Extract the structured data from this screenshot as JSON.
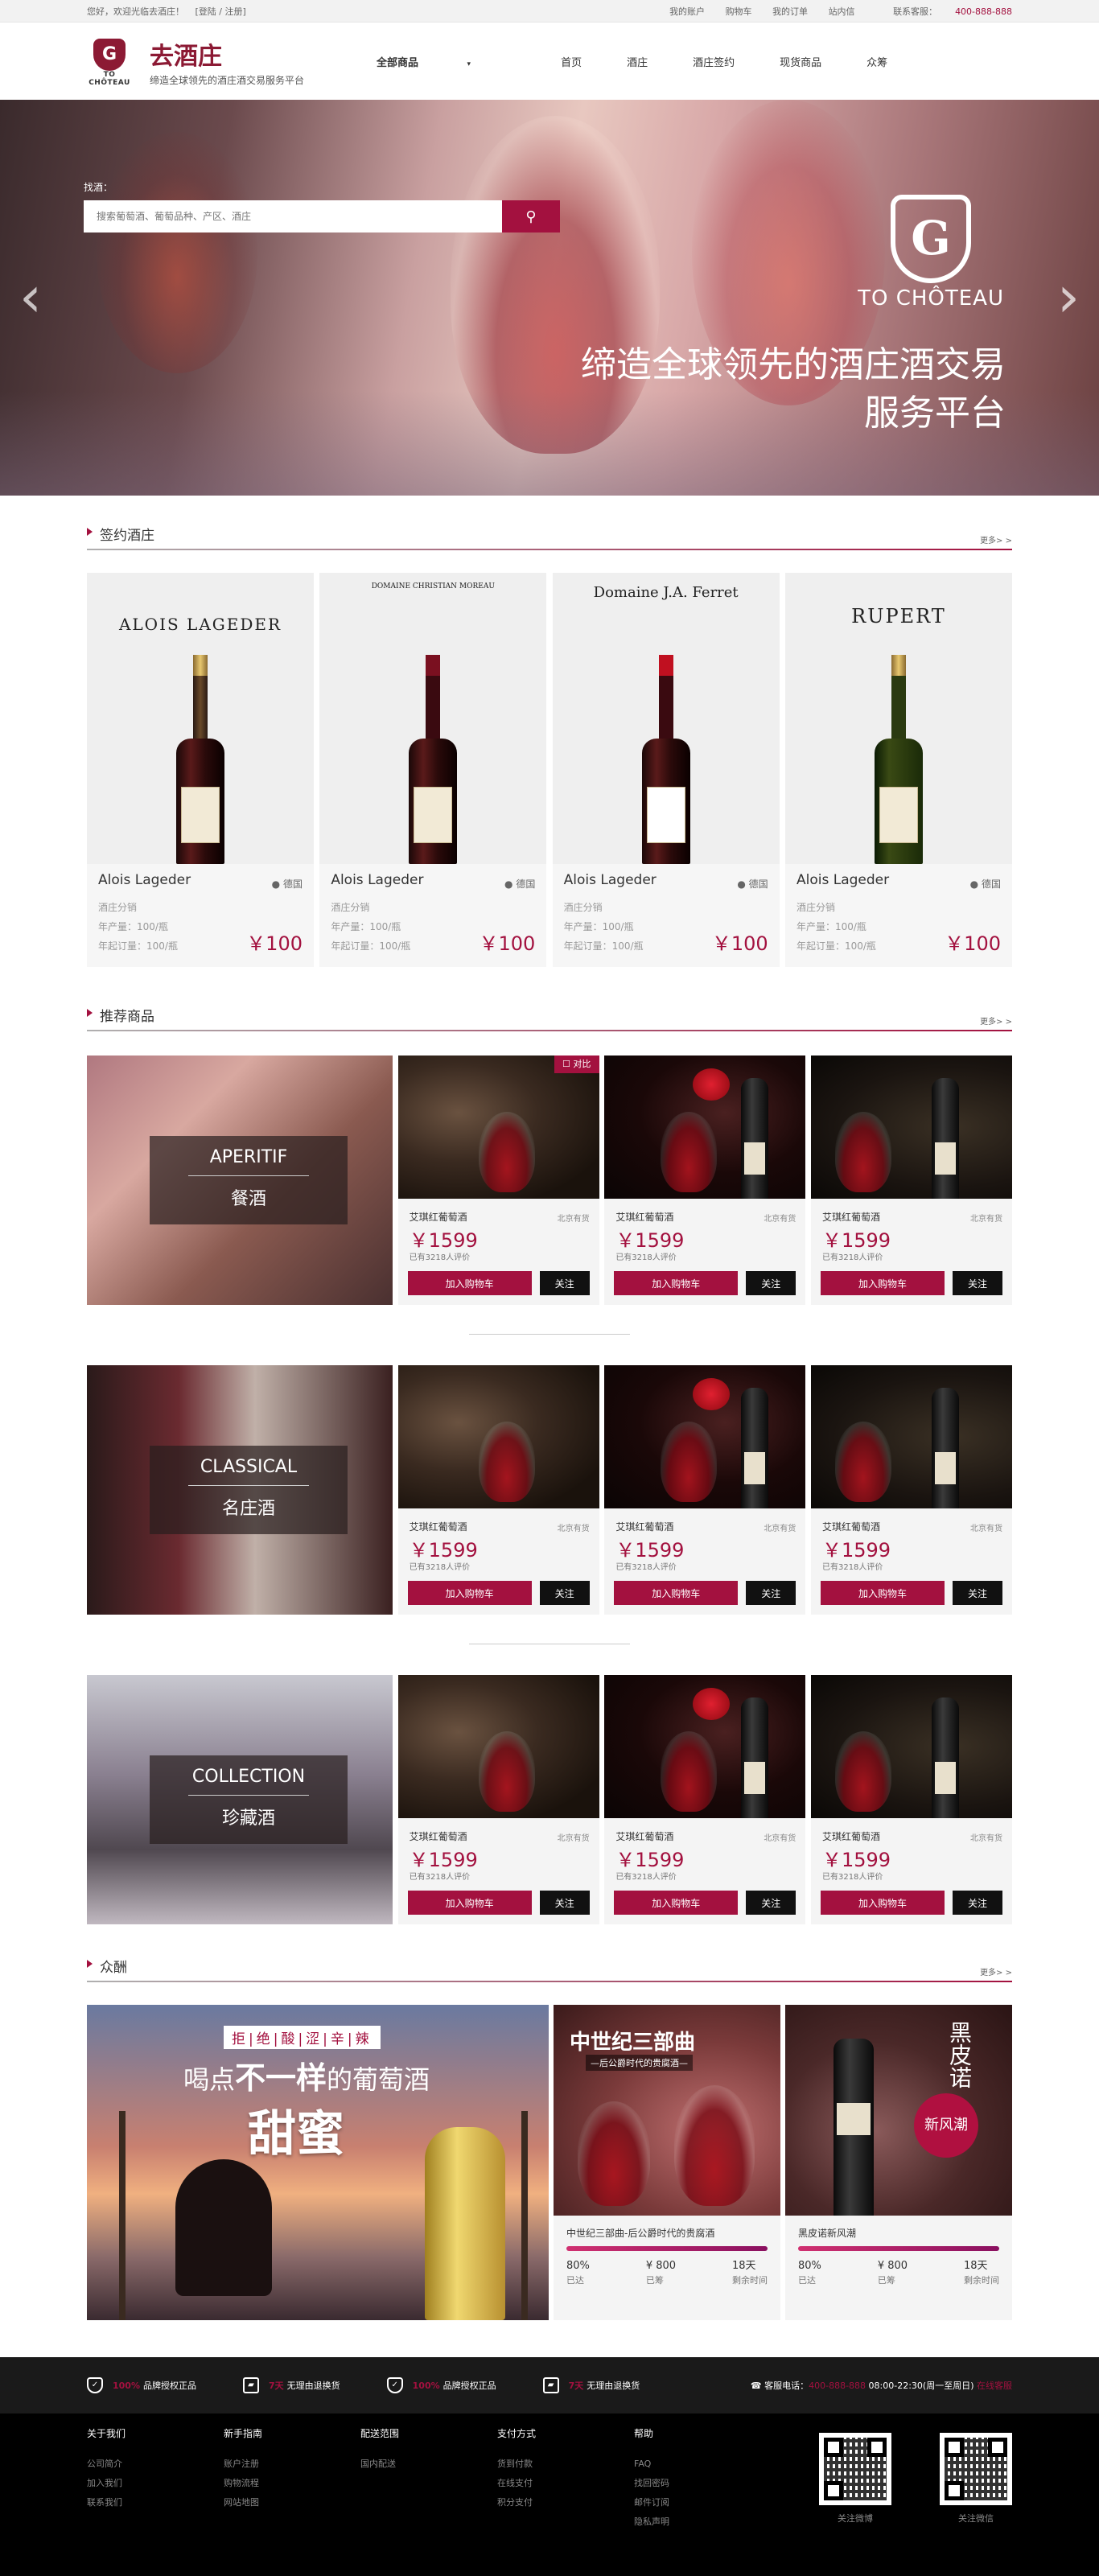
{
  "topbar": {
    "welcome": "您好，欢迎光临去酒庄！",
    "login": "[登陆 / 注册]",
    "links": [
      "我的账户",
      "购物车",
      "我的订单",
      "站内信"
    ],
    "contact_label": "联系客服：",
    "phone": "400-888-888"
  },
  "header": {
    "logo_en": "TO CHÔTEAU",
    "logo_cn": "去酒庄",
    "slogan": "缔造全球领先的酒庄酒交易服务平台",
    "nav": [
      "全部商品",
      "首页",
      "酒庄",
      "酒庄签约",
      "现货商品",
      "众筹"
    ]
  },
  "hero": {
    "search_label": "找酒：",
    "search_placeholder": "搜索葡萄酒、葡萄品种、产区、酒庄",
    "search_icon": "search-icon",
    "logo_en": "TO CHÔTEAU",
    "slogan_lines": [
      "缔造全球领先的酒庄酒交易",
      "服务平台"
    ]
  },
  "sections": {
    "signed": "签约酒庄",
    "recommend": "推荐商品",
    "crowd": "众酬",
    "more": "更多> >"
  },
  "chateaus": [
    {
      "brand": "ALOIS LAGEDER",
      "name": "Alois Lageder",
      "location": "德国",
      "branch": "酒庄分销",
      "output": "年产量：100/瓶",
      "min_order": "年起订量：100/瓶",
      "price": "￥100"
    },
    {
      "brand": "DOMAINE CHRISTIAN MOREAU",
      "name": "Alois Lageder",
      "location": "德国",
      "branch": "酒庄分销",
      "output": "年产量：100/瓶",
      "min_order": "年起订量：100/瓶",
      "price": "￥100"
    },
    {
      "brand": "Domaine J.A. Ferret",
      "name": "Alois Lageder",
      "location": "德国",
      "branch": "酒庄分销",
      "output": "年产量：100/瓶",
      "min_order": "年起订量：100/瓶",
      "price": "￥100"
    },
    {
      "brand": "RUPERT",
      "name": "Alois Lageder",
      "location": "德国",
      "branch": "酒庄分销",
      "output": "年产量：100/瓶",
      "min_order": "年起订量：100/瓶",
      "price": "￥100"
    }
  ],
  "recommend_rows": [
    {
      "en": "APERITIF",
      "cn": "餐酒"
    },
    {
      "en": "CLASSICAL",
      "cn": "名庄酒"
    },
    {
      "en": "COLLECTION",
      "cn": "珍藏酒"
    }
  ],
  "product": {
    "title": "艾琪红葡萄酒",
    "stock": "北京有货",
    "price": "￥1599",
    "reviews": "已有3218人评价",
    "cart": "加入购物车",
    "follow": "关注",
    "compare": "☐ 对比"
  },
  "crowd": {
    "big": {
      "ribbon": "拒|绝|酸|涩|辛|辣",
      "line1_a": "喝点",
      "line1_b": "不一样",
      "line1_c": "的葡萄酒",
      "line2": "甜蜜"
    },
    "cards": [
      {
        "img_title": "中世纪三部曲",
        "img_sub": "—后公爵时代的贵腐酒—",
        "title": "中世纪三部曲-后公爵时代的贵腐酒",
        "pct": "80%",
        "pct_label": "已达",
        "amount": "¥ 800",
        "amount_label": "已筹",
        "days": "18天",
        "days_label": "剩余时间"
      },
      {
        "img_title": "黑皮诺",
        "img_sub": "新风潮",
        "title": "黑皮诺新风潮",
        "pct": "80%",
        "pct_label": "已达",
        "amount": "¥ 800",
        "amount_label": "已筹",
        "days": "18天",
        "days_label": "剩余时间"
      }
    ]
  },
  "footer": {
    "badges": [
      {
        "hl": "100%",
        "text": "品牌授权正品"
      },
      {
        "hl": "7天",
        "text": "无理由退换货"
      },
      {
        "hl": "100%",
        "text": "品牌授权正品"
      },
      {
        "hl": "7天",
        "text": "无理由退换货"
      }
    ],
    "service_label": "客服电话：",
    "service_phone": "400-888-888",
    "service_hours": "08:00-22:30(周一至周日)",
    "online": "在线客服",
    "cols": [
      {
        "title": "关于我们",
        "items": [
          "公司简介",
          "加入我们",
          "联系我们"
        ]
      },
      {
        "title": "新手指南",
        "items": [
          "账户注册",
          "购物流程",
          "网站地图"
        ]
      },
      {
        "title": "配送范围",
        "items": [
          "国内配送"
        ]
      },
      {
        "title": "支付方式",
        "items": [
          "货到付款",
          "在线支付",
          "积分支付"
        ]
      },
      {
        "title": "帮助",
        "items": [
          "FAQ",
          "找回密码",
          "邮件订阅",
          "隐私声明"
        ]
      }
    ],
    "qr": [
      "关注微博",
      "关注微信"
    ]
  }
}
